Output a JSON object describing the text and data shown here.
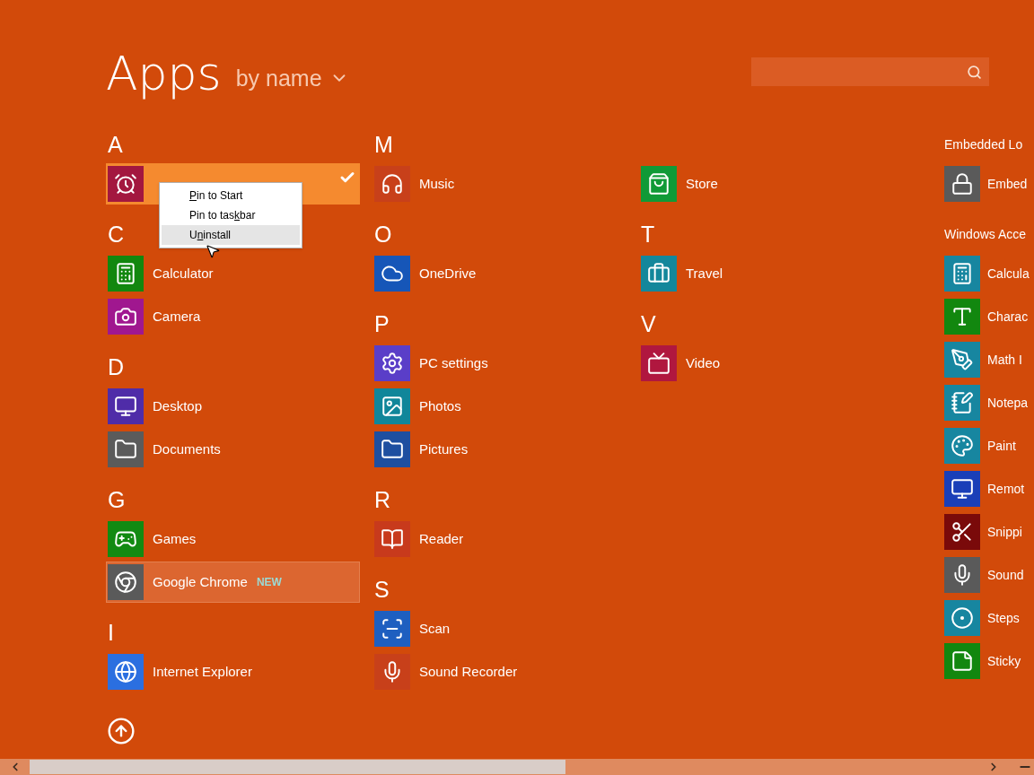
{
  "header": {
    "title": "Apps",
    "sort": "by name"
  },
  "columns": [
    {
      "groups": [
        {
          "letter": "A",
          "items": [
            {
              "kind": "alarm",
              "color": "#a3173f",
              "selected": true,
              "highlighted": false
            }
          ]
        },
        {
          "letter": "C",
          "items": [
            {
              "name": "Calculator",
              "kind": "calculator",
              "color": "#12870f",
              "selected": false,
              "highlighted": false
            },
            {
              "name": "Camera",
              "kind": "camera",
              "color": "#a0178f",
              "selected": false,
              "highlighted": false
            }
          ]
        },
        {
          "letter": "D",
          "items": [
            {
              "name": "Desktop",
              "kind": "desktop",
              "color": "#4f2ca8",
              "selected": false,
              "highlighted": false
            },
            {
              "name": "Documents",
              "kind": "folder",
              "color": "#5b5b5b",
              "selected": false,
              "highlighted": false
            }
          ]
        },
        {
          "letter": "G",
          "items": [
            {
              "name": "Games",
              "kind": "games",
              "color": "#128a12",
              "selected": false,
              "highlighted": false
            },
            {
              "name": "Google Chrome",
              "kind": "chrome",
              "color": "#5a5a5a",
              "selected": false,
              "highlighted": true,
              "badge": "NEW"
            }
          ]
        },
        {
          "letter": "I",
          "items": [
            {
              "name": "Internet Explorer",
              "kind": "globe",
              "color": "#2b6fe0",
              "selected": false,
              "highlighted": false
            }
          ]
        }
      ]
    },
    {
      "groups": [
        {
          "letter": "M",
          "items": [
            {
              "name": "Music",
              "kind": "headphones",
              "color": "#c8401a",
              "selected": false,
              "highlighted": false
            }
          ]
        },
        {
          "letter": "O",
          "items": [
            {
              "name": "OneDrive",
              "kind": "cloud",
              "color": "#1656b8",
              "selected": false,
              "highlighted": false
            }
          ]
        },
        {
          "letter": "P",
          "items": [
            {
              "name": "PC settings",
              "kind": "gear",
              "color": "#5a3ec8",
              "selected": false,
              "highlighted": false
            },
            {
              "name": "Photos",
              "kind": "image",
              "color": "#10869a",
              "selected": false,
              "highlighted": false
            },
            {
              "name": "Pictures",
              "kind": "folder",
              "color": "#1e4fa0",
              "selected": false,
              "highlighted": false
            }
          ]
        },
        {
          "letter": "R",
          "items": [
            {
              "name": "Reader",
              "kind": "book",
              "color": "#c83a1c",
              "selected": false,
              "highlighted": false
            }
          ]
        },
        {
          "letter": "S",
          "items": [
            {
              "name": "Scan",
              "kind": "scan",
              "color": "#1e5fc0",
              "selected": false,
              "highlighted": false
            },
            {
              "name": "Sound Recorder",
              "kind": "mic",
              "color": "#c8401a",
              "selected": false,
              "highlighted": false
            }
          ]
        }
      ]
    },
    {
      "groups": [
        {
          "items": [
            {
              "name": "Store",
              "kind": "bag",
              "color": "#109a37",
              "selected": false,
              "highlighted": false
            }
          ]
        },
        {
          "letter": "T",
          "items": [
            {
              "name": "Travel",
              "kind": "briefcase",
              "color": "#14879b",
              "selected": false,
              "highlighted": false
            }
          ]
        },
        {
          "letter": "V",
          "items": [
            {
              "name": "Video",
              "kind": "video",
              "color": "#b0173f",
              "selected": false,
              "highlighted": false
            }
          ]
        }
      ]
    },
    {
      "groups": [
        {
          "heading": "Embedded Lo",
          "items": [
            {
              "name": "Embed",
              "kind": "lock",
              "color": "#5a5a5a",
              "selected": false,
              "highlighted": false
            }
          ]
        },
        {
          "heading": "Windows Acce",
          "items": [
            {
              "name": "Calcula",
              "kind": "calculator",
              "color": "#1786a0",
              "selected": false,
              "highlighted": false
            },
            {
              "name": "Charac",
              "kind": "type",
              "color": "#12870f",
              "selected": false,
              "highlighted": false
            },
            {
              "name": "Math I",
              "kind": "pen",
              "color": "#1786a0",
              "selected": false,
              "highlighted": false
            },
            {
              "name": "Notepa",
              "kind": "notepad",
              "color": "#1786a0",
              "selected": false,
              "highlighted": false
            },
            {
              "name": "Paint",
              "kind": "palette",
              "color": "#1786a0",
              "selected": false,
              "highlighted": false
            },
            {
              "name": "Remot",
              "kind": "desktop",
              "color": "#1a3fb8",
              "selected": false,
              "highlighted": false
            },
            {
              "name": "Snippi",
              "kind": "scissors",
              "color": "#7a0a0a",
              "selected": false,
              "highlighted": false
            },
            {
              "name": "Sound",
              "kind": "mic",
              "color": "#5a5a5a",
              "selected": false,
              "highlighted": false
            },
            {
              "name": "Steps",
              "kind": "record",
              "color": "#1786a0",
              "selected": false,
              "highlighted": false
            },
            {
              "name": "Sticky",
              "kind": "sticky",
              "color": "#12870f",
              "selected": false,
              "highlighted": false
            }
          ]
        }
      ]
    }
  ],
  "context_menu": {
    "items": [
      {
        "key": "P",
        "post": "in to Start",
        "selected": false
      },
      {
        "pre": "Pin to tas",
        "key": "k",
        "post": "bar",
        "selected": false
      },
      {
        "pre": "U",
        "key": "n",
        "post": "install",
        "selected": true
      }
    ]
  }
}
